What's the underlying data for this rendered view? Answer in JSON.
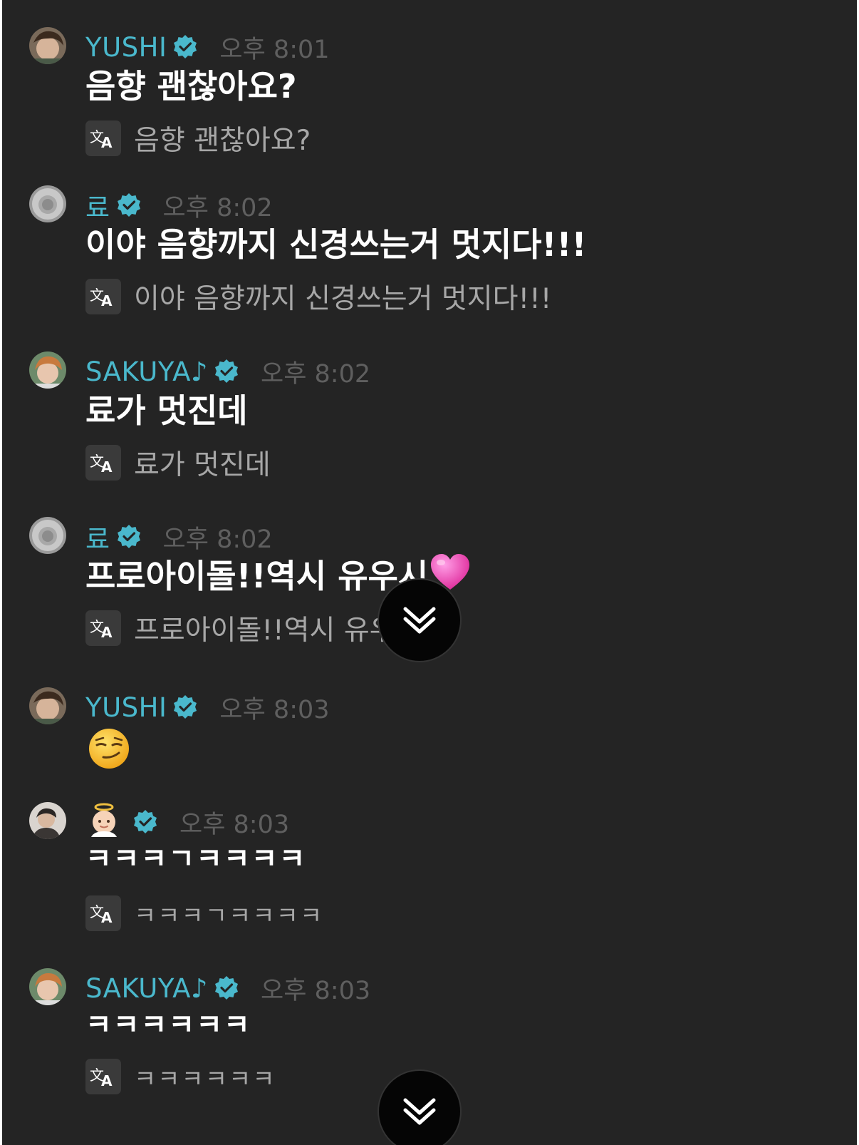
{
  "chat": {
    "messages": [
      {
        "sender": "YUSHI",
        "time": "오후 8:01",
        "text": "음향 괜찮아요?",
        "translation": "음향 괜찮아요?"
      },
      {
        "sender": "료",
        "time": "오후 8:02",
        "text": "이야 음향까지 신경쓰는거 멋지다!!!",
        "translation": "이야 음향까지 신경쓰는거 멋지다!!!"
      },
      {
        "sender": "SAKUYA♪",
        "time": "오후 8:02",
        "text": "료가 멋진데",
        "translation": "료가 멋진데"
      },
      {
        "sender": "료",
        "time": "오후 8:02",
        "text": "프로아이돌!!역시 유우시",
        "text_emoji": "pink-heart-emoji",
        "translation": "프로아이돌!!역시 유우"
      },
      {
        "sender": "YUSHI",
        "time": "오후 8:03",
        "text_emoji": "smirking-face-emoji"
      },
      {
        "sender_emoji": "baby-angel-emoji",
        "time": "오후 8:03",
        "text": "ㅋㅋㅋㄱㅋㅋㅋㅋ",
        "translation": "ㅋㅋㅋㄱㅋㅋㅋㅋ"
      },
      {
        "sender": "SAKUYA♪",
        "time": "오후 8:03",
        "text": "ㅋㅋㅋㅋㅋㅋ",
        "translation": "ㅋㅋㅋㅋㅋㅋ"
      }
    ],
    "scroll_button_icon": "double-chevron-down-icon"
  },
  "colors": {
    "background": "#242424",
    "sender_name": "#4ab8cc",
    "verified_badge": "#4ab8cc",
    "timestamp": "#5f5f5f",
    "message_text": "#ffffff",
    "translation_text": "#a7a7a7",
    "translate_icon_bg": "#3a3a3a"
  }
}
